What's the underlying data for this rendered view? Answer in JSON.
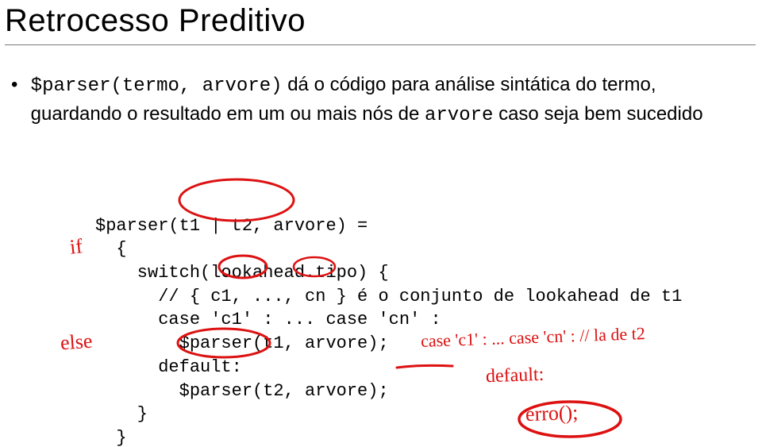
{
  "title": "Retrocesso Preditivo",
  "bullet": {
    "text_before_code1": "",
    "code1": "$parser(termo, arvore)",
    "text_mid1": " dá o código para análise sintática do termo, guardando o resultado em um ou mais nós de ",
    "code2": "arvore",
    "text_after": " caso seja bem sucedido"
  },
  "code": {
    "l1": "$parser(t1 | t2, arvore) =",
    "l2": "  {",
    "l3": "    switch(lookahead.tipo) {",
    "l4": "      // { c1, ..., cn } é o conjunto de lookahead de t1",
    "l5": "      case 'c1' : ... case 'cn' :",
    "l6": "        $parser(t1, arvore);",
    "l7": "      default:",
    "l8": "        $parser(t2, arvore);",
    "l9": "    }",
    "l10": "  }"
  },
  "handwriting": {
    "if": "if",
    "else": "else",
    "caseline": "case 'c1' : ... case 'cn' : // la de t2",
    "default": "default:",
    "error": "erro();"
  }
}
